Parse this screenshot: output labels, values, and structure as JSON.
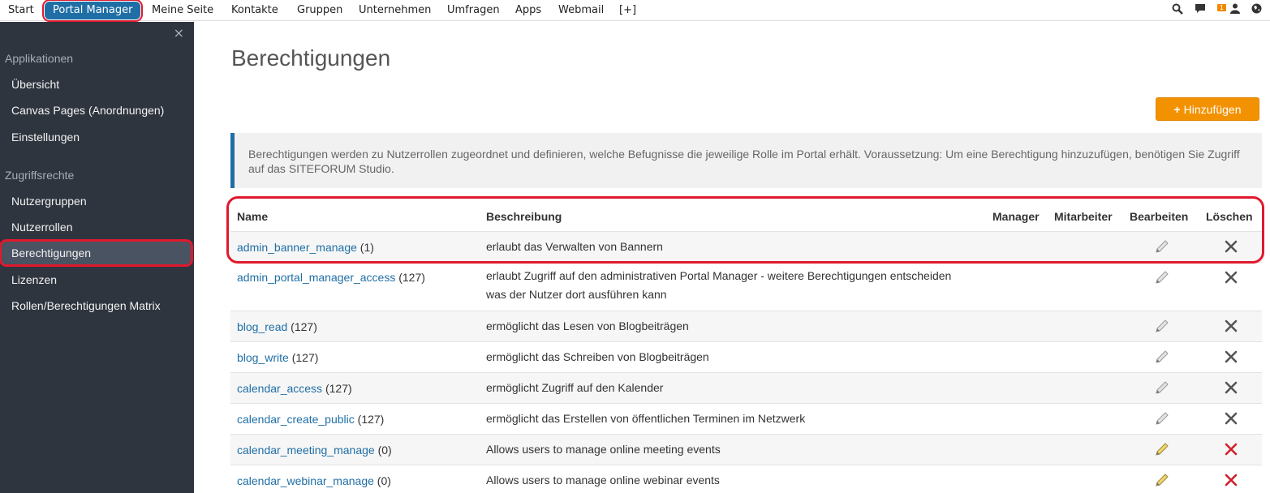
{
  "topnav": {
    "items": [
      {
        "label": "Start"
      },
      {
        "label": "Portal Manager"
      },
      {
        "label": "Meine Seite"
      },
      {
        "label": "Kontakte"
      },
      {
        "label": "Gruppen"
      },
      {
        "label": "Unternehmen"
      },
      {
        "label": "Umfragen"
      },
      {
        "label": "Apps"
      },
      {
        "label": "Webmail"
      },
      {
        "label": "[+]"
      }
    ],
    "messages_badge": "1"
  },
  "sidebar": {
    "close": "×",
    "section_apps": "Applikationen",
    "apps": [
      {
        "label": "Übersicht"
      },
      {
        "label": "Canvas Pages (Anordnungen)"
      },
      {
        "label": "Einstellungen"
      }
    ],
    "section_access": "Zugriffsrechte",
    "access": [
      {
        "label": "Nutzergruppen"
      },
      {
        "label": "Nutzerrollen"
      },
      {
        "label": "Berechtigungen"
      },
      {
        "label": "Lizenzen"
      },
      {
        "label": "Rollen/Berechtigungen Matrix"
      }
    ]
  },
  "main": {
    "title": "Berechtigungen",
    "add_button": "Hinzufügen",
    "add_button_plus": "+",
    "info": "Berechtigungen werden zu Nutzerrollen zugeordnet und definieren, welche Befugnisse die jeweilige Rolle im Portal erhält. Voraussetzung: Um eine Berechtigung hinzuzufügen, benötigen Sie Zugriff auf das SITEFORUM Studio."
  },
  "table": {
    "headers": {
      "name": "Name",
      "description": "Beschreibung",
      "manager": "Manager",
      "employee": "Mitarbeiter",
      "edit": "Bearbeiten",
      "delete": "Löschen"
    },
    "rows": [
      {
        "name": "admin_banner_manage",
        "count": "(1)",
        "desc": "erlaubt das Verwalten von Bannern",
        "active": false
      },
      {
        "name": "admin_portal_manager_access",
        "count": "(127)",
        "desc": "erlaubt Zugriff auf den administrativen Portal Manager - weitere Berechtigungen entscheiden",
        "desc2": "was der Nutzer dort ausführen kann",
        "active": false
      },
      {
        "name": "blog_read",
        "count": "(127)",
        "desc": "ermöglicht das Lesen von Blogbeiträgen",
        "active": false
      },
      {
        "name": "blog_write",
        "count": "(127)",
        "desc": "ermöglicht das Schreiben von Blogbeiträgen",
        "active": false
      },
      {
        "name": "calendar_access",
        "count": "(127)",
        "desc": "ermöglicht Zugriff auf den Kalender",
        "active": false
      },
      {
        "name": "calendar_create_public",
        "count": "(127)",
        "desc": "ermöglicht das Erstellen von öffentlichen Terminen im Netzwerk",
        "active": false
      },
      {
        "name": "calendar_meeting_manage",
        "count": "(0)",
        "desc": "Allows users to manage online meeting events",
        "active": true
      },
      {
        "name": "calendar_webinar_manage",
        "count": "(0)",
        "desc": "Allows users to manage online webinar events",
        "active": true
      }
    ]
  },
  "colors": {
    "accent_blue": "#1f6fa6",
    "add_orange": "#f39200",
    "highlight_red": "#e0192d",
    "sidebar_bg": "#2f353f"
  }
}
